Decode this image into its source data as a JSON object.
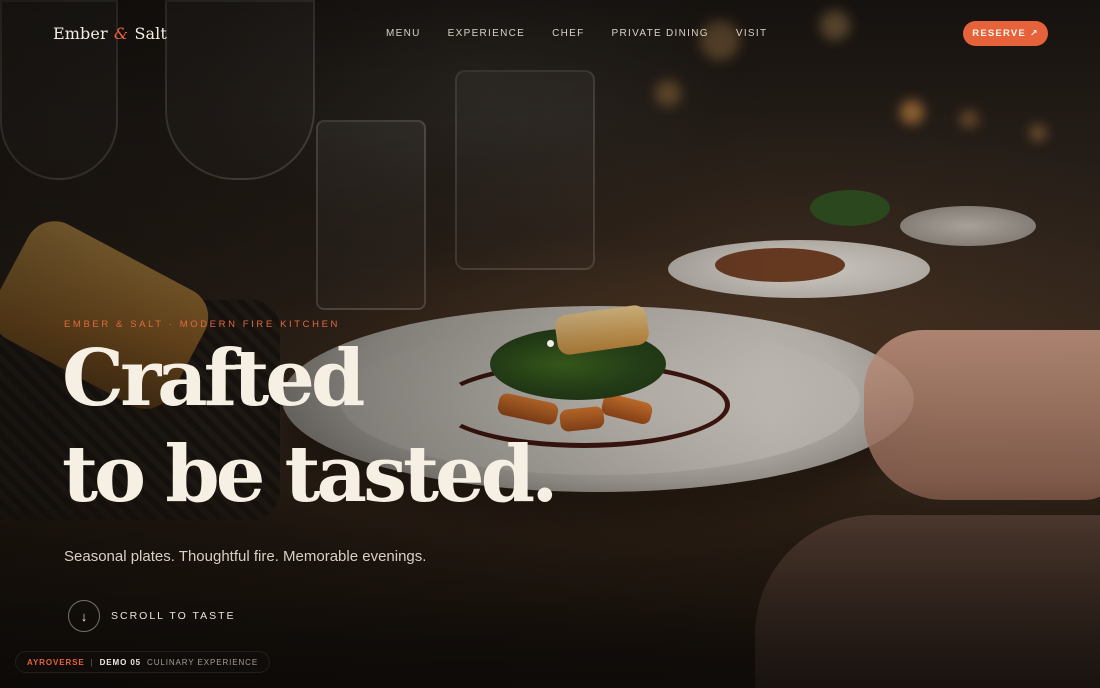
{
  "header": {
    "logo": {
      "part1": "Ember",
      "ampersand": "&",
      "part2": "Salt"
    },
    "nav": [
      {
        "label": "MENU"
      },
      {
        "label": "EXPERIENCE"
      },
      {
        "label": "CHEF"
      },
      {
        "label": "PRIVATE DINING"
      },
      {
        "label": "VISIT"
      }
    ],
    "reserve": {
      "label": "RESERVE",
      "icon": "↗"
    }
  },
  "hero": {
    "eyebrow": "EMBER & SALT · MODERN FIRE KITCHEN",
    "headline_line1": "Crafted",
    "headline_line2": "to be tasted.",
    "subtitle": "Seasonal plates. Thoughtful fire. Memorable evenings.",
    "scroll": {
      "icon": "↓",
      "label": "SCROLL TO TASTE"
    }
  },
  "badge": {
    "brand": "AYROVERSE",
    "separator": "|",
    "demo": "DEMO 05",
    "description": "CULINARY EXPERIENCE"
  },
  "colors": {
    "accent": "#e6623a",
    "headline": "#f6efe4",
    "background": "#14100d"
  },
  "icons": {
    "reserve": "arrow-up-right-icon",
    "scroll": "arrow-down-icon"
  }
}
